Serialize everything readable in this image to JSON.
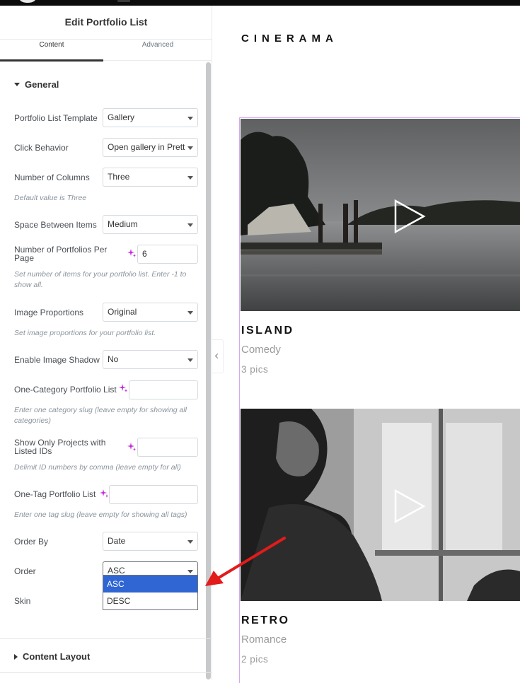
{
  "panel": {
    "title": "Edit Portfolio List",
    "tabs": [
      "Content",
      "Advanced"
    ],
    "general": {
      "heading": "General",
      "fields": {
        "template": {
          "label": "Portfolio List Template",
          "value": "Gallery"
        },
        "click_behavior": {
          "label": "Click Behavior",
          "value": "Open gallery in Prett"
        },
        "columns": {
          "label": "Number of Columns",
          "value": "Three",
          "hint": "Default value is Three"
        },
        "space": {
          "label": "Space Between Items",
          "value": "Medium"
        },
        "per_page": {
          "label": "Number of Portfolios Per Page",
          "value": "6",
          "hint": "Set number of items for your portfolio list. Enter -1 to show all."
        },
        "proportions": {
          "label": "Image Proportions",
          "value": "Original",
          "hint": "Set image proportions for your portfolio list."
        },
        "shadow": {
          "label": "Enable Image Shadow",
          "value": "No"
        },
        "one_category": {
          "label": "One-Category Portfolio List",
          "value": "",
          "hint": "Enter one category slug (leave empty for showing all categories)"
        },
        "listed_ids": {
          "label": "Show Only Projects with Listed IDs",
          "value": "",
          "hint": "Delimit ID numbers by comma (leave empty for all)"
        },
        "one_tag": {
          "label": "One-Tag Portfolio List",
          "value": "",
          "hint": "Enter one tag slug (leave empty for showing all tags)"
        },
        "order_by": {
          "label": "Order By",
          "value": "Date"
        },
        "order": {
          "label": "Order",
          "value": "ASC",
          "options": [
            "ASC",
            "DESC"
          ],
          "highlighted": "ASC"
        },
        "skin": {
          "label": "Skin"
        }
      }
    },
    "content_layout": {
      "heading": "Content Layout"
    }
  },
  "preview": {
    "site_title": "CINERAMA",
    "items": [
      {
        "title": "ISLAND",
        "category": "Comedy",
        "pics": "3 pics"
      },
      {
        "title": "RETRO",
        "category": "Romance",
        "pics": "2 pics"
      }
    ]
  },
  "colors": {
    "accent_highlight": "#2f66d4",
    "annotation_arrow": "#e21b1b",
    "dynamic_tag": "#c02ad9",
    "card_outline": "#d6a8f0"
  },
  "icons": [
    "caret-down-icon",
    "caret-right-icon",
    "sparkle-icon",
    "chevron-left-icon",
    "play-icon",
    "annotation-arrow"
  ]
}
